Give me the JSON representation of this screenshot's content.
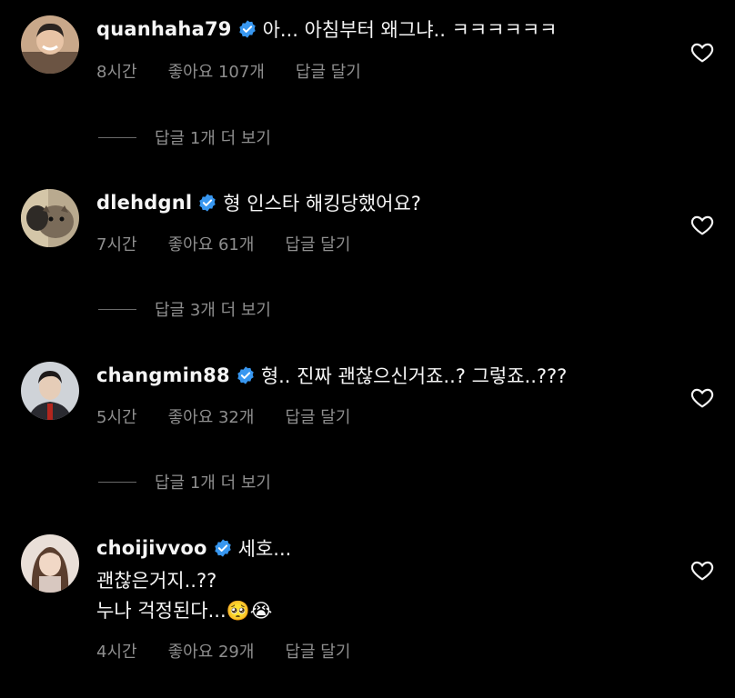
{
  "comments": [
    {
      "username": "quanhaha79",
      "text": "아... 아침부터 왜그냐.. ㅋㅋㅋㅋㅋㅋ",
      "time": "8시간",
      "likes": "좋아요 107개",
      "reply": "답글 달기",
      "view_replies": "답글 1개 더 보기"
    },
    {
      "username": "dlehdgnl",
      "text": "형 인스타 해킹당했어요?",
      "time": "7시간",
      "likes": "좋아요 61개",
      "reply": "답글 달기",
      "view_replies": "답글 3개 더 보기"
    },
    {
      "username": "changmin88",
      "text": "형.. 진짜 괜찮으신거죠..? 그렇죠..???",
      "time": "5시간",
      "likes": "좋아요 32개",
      "reply": "답글 달기",
      "view_replies": "답글 1개 더 보기"
    },
    {
      "username": "choijivvoo",
      "text": "세호...",
      "text_line2": "괜찮은거지..??",
      "text_line3": "누나 걱정된다...🥺😭",
      "time": "4시간",
      "likes": "좋아요 29개",
      "reply": "답글 달기"
    }
  ],
  "colors": {
    "background": "#000000",
    "primary_text": "#f5f5f5",
    "secondary_text": "#8e8e8e",
    "verified_badge": "#3897f0"
  },
  "icons": {
    "verified": "verified-badge-icon",
    "like": "heart-outline-icon"
  }
}
